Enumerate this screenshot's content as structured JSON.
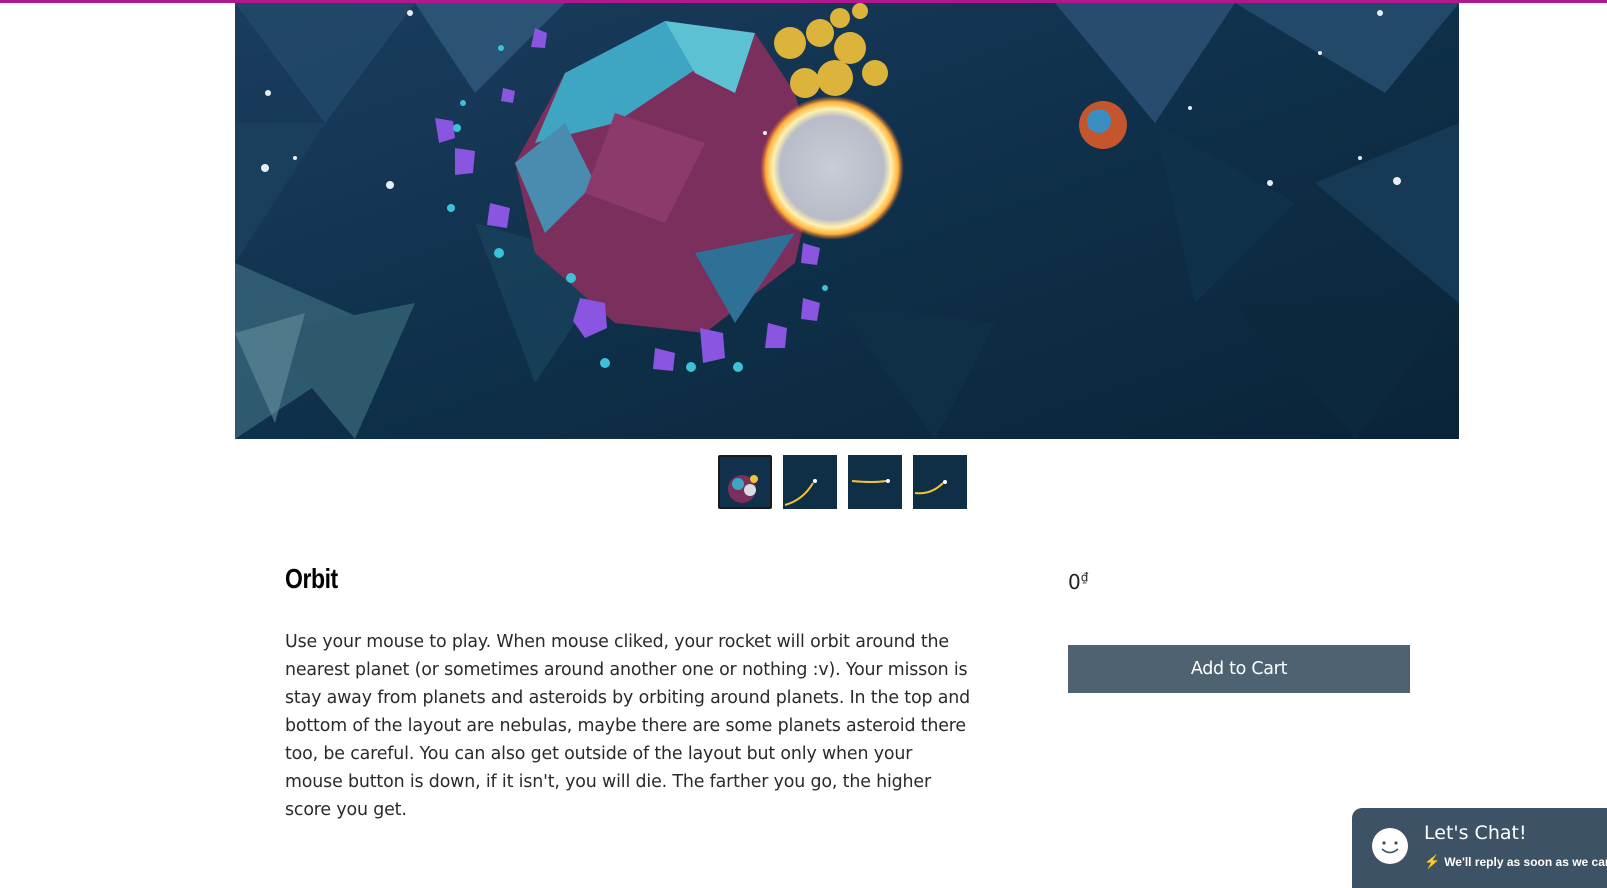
{
  "colors": {
    "accent_top_bar": "#b0188e",
    "button_bg": "#4f6271",
    "chat_bg": "#3d5264"
  },
  "product": {
    "title": "Orbit",
    "price_amount": "0",
    "price_currency": "₫",
    "description": "Use your mouse to play. When mouse cliked, your rocket will orbit around the nearest planet (or sometimes around another one or nothing :v). Your misson is stay away from planets and asteroids by orbiting around planets. In the top and bottom of the layout are nebulas, maybe there are some planets asteroid there too, be careful. You can also get outside of the layout but only when your mouse button is down, if it isn't, you will die. The farther you go, the higher score you get.",
    "add_to_cart_label": "Add to Cart"
  },
  "gallery": {
    "thumbnails": [
      {
        "name": "gallery-thumb-1",
        "active": true
      },
      {
        "name": "gallery-thumb-2",
        "active": false
      },
      {
        "name": "gallery-thumb-3",
        "active": false
      },
      {
        "name": "gallery-thumb-4",
        "active": false
      }
    ]
  },
  "chat": {
    "title": "Let's Chat!",
    "subtitle": "We'll reply as soon as we can",
    "icon": "smiley-face-icon",
    "subtitle_icon": "lightning-bolt-icon"
  }
}
